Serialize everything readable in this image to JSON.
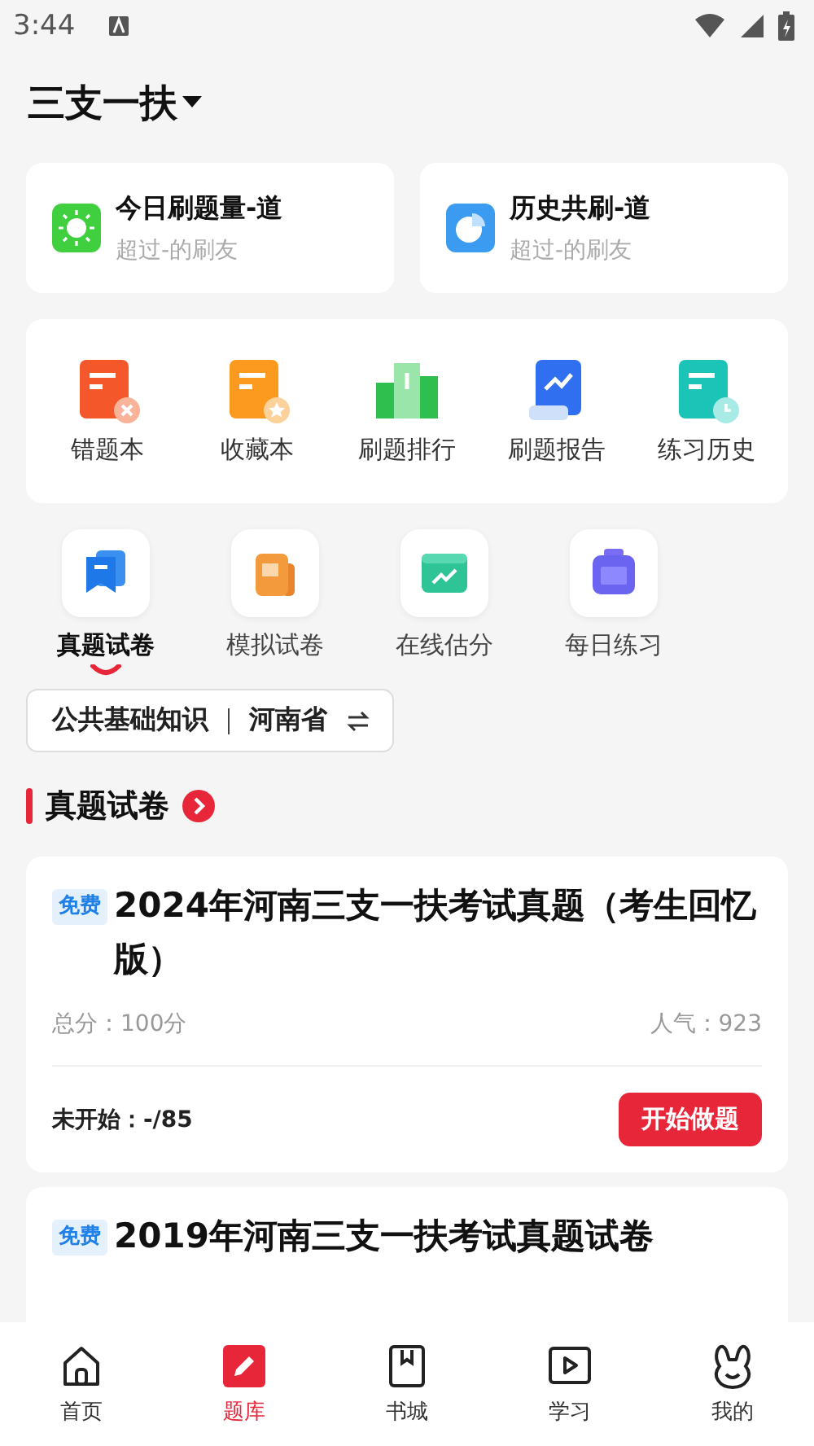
{
  "status_bar": {
    "time": "3:44"
  },
  "header": {
    "title": "三支一扶"
  },
  "stats": [
    {
      "kind": "sun",
      "label": "今日刷题量-道",
      "sub": "超过-的刷友"
    },
    {
      "kind": "pie",
      "label": "历史共刷-道",
      "sub": "超过-的刷友"
    }
  ],
  "tools": [
    {
      "kind": "wrong",
      "label": "错题本"
    },
    {
      "kind": "star",
      "label": "收藏本"
    },
    {
      "kind": "rank",
      "label": "刷题排行"
    },
    {
      "kind": "report",
      "label": "刷题报告"
    },
    {
      "kind": "history",
      "label": "练习历史"
    }
  ],
  "categories": [
    {
      "kind": "real",
      "label": "真题试卷",
      "selected": true
    },
    {
      "kind": "mock",
      "label": "模拟试卷",
      "selected": false
    },
    {
      "kind": "score",
      "label": "在线估分",
      "selected": false
    },
    {
      "kind": "daily",
      "label": "每日练习",
      "selected": false
    }
  ],
  "filter": {
    "subject": "公共基础知识",
    "region": "河南省"
  },
  "section": {
    "title": "真题试卷"
  },
  "papers": [
    {
      "tag": "免费",
      "title": "2024年河南三支一扶考试真题（考生回忆版）",
      "total": "总分：100分",
      "popularity": "人气：923",
      "progress": "未开始：-/85",
      "action": "开始做题"
    },
    {
      "tag": "免费",
      "title": "2019年河南三支一扶考试真题试卷"
    }
  ],
  "nav": [
    {
      "kind": "home",
      "label": "首页",
      "selected": false
    },
    {
      "kind": "bank",
      "label": "题库",
      "selected": true
    },
    {
      "kind": "book",
      "label": "书城",
      "selected": false
    },
    {
      "kind": "study",
      "label": "学习",
      "selected": false
    },
    {
      "kind": "me",
      "label": "我的",
      "selected": false
    }
  ]
}
